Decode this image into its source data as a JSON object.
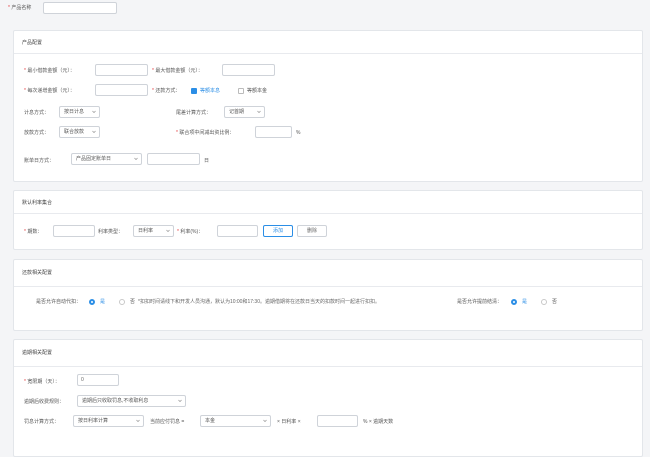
{
  "product_name": {
    "label": "产品名称",
    "value": ""
  },
  "product_config": {
    "title": "产品配置",
    "min_loan_label": "最小借款金额（元）：",
    "max_loan_label": "最大借款金额（元）：",
    "per_increment_label": "每次递增金额（元）：",
    "repay_method_label": "还款方式：",
    "repay_opt1": "等额本息",
    "repay_opt2": "等额本金",
    "interest_calc_label": "计息方式：",
    "interest_calc_value": "按日计息",
    "tail_calc_label": "尾差计算方式：",
    "tail_calc_value": "记首期",
    "loan_method_label": "放款方式：",
    "loan_method_value": "联合放款",
    "joint_ratio_label": "联合项中间减出资比例：",
    "percent_unit": "%",
    "bill_date_label": "账单日方式：",
    "bill_date_value": "产品固定账单日",
    "day_unit": "日"
  },
  "rate_set": {
    "title": "默认利率集合",
    "periods_label": "期数：",
    "rate_type_label": "利率类型：",
    "rate_type_value": "日利率",
    "rate_label": "利率(%)：",
    "add_button": "添加",
    "delete_button": "删除"
  },
  "repay_config": {
    "title": "还款相关配置",
    "auto_deduct_label": "是否允许自动代扣：",
    "yes": "是",
    "no": "否",
    "note": "*扣扣时间请线下和开发人员沟通，默认为10:00和17:30。逾期借期将在还款日当天的扣款时间一起进行扣扣。",
    "early_repay_label": "是否允许提前结清："
  },
  "overdue_config": {
    "title": "逾期相关配置",
    "grace_label": "宽限期（天）：",
    "grace_value": "0",
    "overdue_rule_label": "逾期后收费规则：",
    "overdue_rule_value": "逾期后只收取罚息,不收取利息",
    "penalty_label": "罚息计算方式：",
    "penalty_method_value": "按日利率计算",
    "current_due_label": "当前应付罚息 =",
    "principal_value": "本金",
    "times_daily_rate": "× 日利率 ×",
    "formula_tail": "% × 逾期天数"
  },
  "colors": {
    "accent": "#2b8ee6",
    "required": "#e4393c"
  }
}
